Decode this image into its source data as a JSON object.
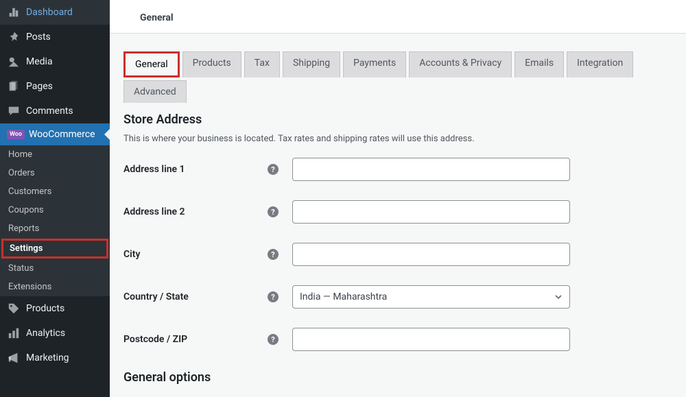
{
  "sidebar": {
    "items": [
      {
        "label": "Dashboard",
        "icon": "dashboard"
      },
      {
        "label": "Posts",
        "icon": "pin"
      },
      {
        "label": "Media",
        "icon": "media"
      },
      {
        "label": "Pages",
        "icon": "page"
      },
      {
        "label": "Comments",
        "icon": "comment"
      },
      {
        "label": "WooCommerce",
        "icon": "woo",
        "active": true
      },
      {
        "label": "Products",
        "icon": "products"
      },
      {
        "label": "Analytics",
        "icon": "analytics"
      },
      {
        "label": "Marketing",
        "icon": "marketing"
      }
    ],
    "woo_sub": [
      {
        "label": "Home"
      },
      {
        "label": "Orders"
      },
      {
        "label": "Customers"
      },
      {
        "label": "Coupons"
      },
      {
        "label": "Reports"
      },
      {
        "label": "Settings",
        "current": true,
        "highlight": true
      },
      {
        "label": "Status"
      },
      {
        "label": "Extensions"
      }
    ]
  },
  "top_tab": "General",
  "tabs": [
    {
      "label": "General",
      "active": true
    },
    {
      "label": "Products"
    },
    {
      "label": "Tax"
    },
    {
      "label": "Shipping"
    },
    {
      "label": "Payments"
    },
    {
      "label": "Accounts & Privacy"
    },
    {
      "label": "Emails"
    },
    {
      "label": "Integration"
    },
    {
      "label": "Advanced"
    }
  ],
  "section": {
    "title": "Store Address",
    "desc": "This is where your business is located. Tax rates and shipping rates will use this address."
  },
  "form": {
    "addr1": {
      "label": "Address line 1",
      "value": ""
    },
    "addr2": {
      "label": "Address line 2",
      "value": ""
    },
    "city": {
      "label": "City",
      "value": ""
    },
    "country": {
      "label": "Country / State",
      "value": "India — Maharashtra"
    },
    "postcode": {
      "label": "Postcode / ZIP",
      "value": ""
    }
  },
  "section2": {
    "title": "General options"
  }
}
